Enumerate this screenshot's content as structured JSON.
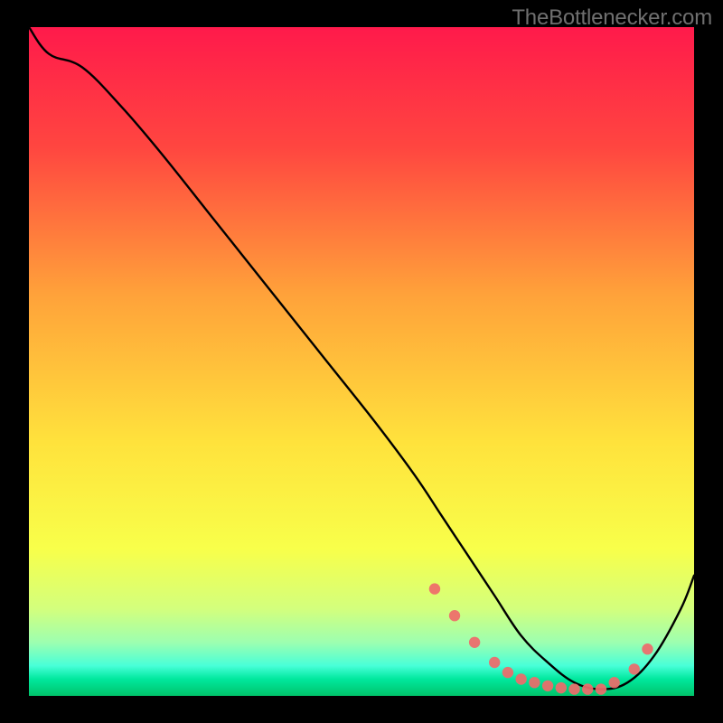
{
  "watermark": "TheBottlenecker.com",
  "chart_data": {
    "type": "line",
    "title": "",
    "xlabel": "",
    "ylabel": "",
    "xlim": [
      0,
      100
    ],
    "ylim": [
      0,
      100
    ],
    "grid": false,
    "series": [
      {
        "name": "curve",
        "x": [
          0,
          3,
          8,
          14,
          20,
          28,
          36,
          44,
          52,
          58,
          62,
          66,
          70,
          74,
          78,
          82,
          86,
          90,
          94,
          98,
          100
        ],
        "y": [
          100,
          96,
          94,
          88,
          81,
          71,
          61,
          51,
          41,
          33,
          27,
          21,
          15,
          9,
          5,
          2,
          1,
          2,
          6,
          13,
          18
        ]
      }
    ],
    "markers": {
      "name": "dots",
      "x": [
        61,
        64,
        67,
        70,
        72,
        74,
        76,
        78,
        80,
        82,
        84,
        86,
        88,
        91,
        93
      ],
      "y": [
        16,
        12,
        8,
        5,
        3.5,
        2.5,
        2,
        1.5,
        1.2,
        1,
        1,
        1,
        2,
        4,
        7
      ]
    },
    "background": {
      "stops": [
        {
          "offset": 0.0,
          "color": "#ff1a4b"
        },
        {
          "offset": 0.18,
          "color": "#ff4640"
        },
        {
          "offset": 0.4,
          "color": "#ffa23a"
        },
        {
          "offset": 0.62,
          "color": "#ffe23c"
        },
        {
          "offset": 0.78,
          "color": "#f8ff4a"
        },
        {
          "offset": 0.87,
          "color": "#d3ff7d"
        },
        {
          "offset": 0.92,
          "color": "#9dffb0"
        },
        {
          "offset": 0.955,
          "color": "#48ffd8"
        },
        {
          "offset": 0.975,
          "color": "#00e89d"
        },
        {
          "offset": 1.0,
          "color": "#00c36a"
        }
      ]
    }
  }
}
